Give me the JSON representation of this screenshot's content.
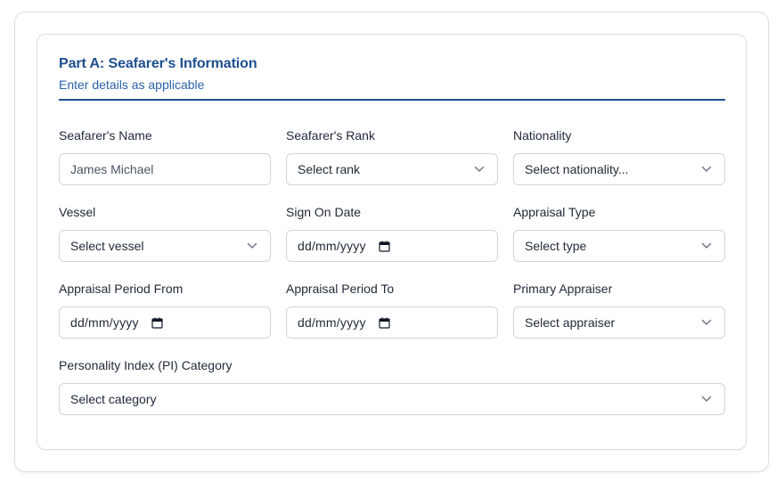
{
  "section": {
    "title": "Part A: Seafarer's Information",
    "subtitle": "Enter details as applicable"
  },
  "fields": {
    "seafarer_name": {
      "label": "Seafarer's Name",
      "value": "James Michael"
    },
    "seafarer_rank": {
      "label": "Seafarer's Rank",
      "value": "Select rank"
    },
    "nationality": {
      "label": "Nationality",
      "value": "Select nationality..."
    },
    "vessel": {
      "label": "Vessel",
      "value": "Select vessel"
    },
    "sign_on_date": {
      "label": "Sign On Date",
      "value": "dd/mm/yyyy"
    },
    "appraisal_type": {
      "label": "Appraisal Type",
      "value": "Select type"
    },
    "period_from": {
      "label": "Appraisal Period From",
      "value": "dd/mm/yyyy"
    },
    "period_to": {
      "label": "Appraisal Period To",
      "value": "dd/mm/yyyy"
    },
    "primary_appraiser": {
      "label": "Primary Appraiser",
      "value": "Select appraiser"
    },
    "pi_category": {
      "label": "Personality Index (PI) Category",
      "value": "Select category"
    }
  },
  "icons": {
    "dropdown": "chevron-down-icon",
    "date": "calendar-icon"
  },
  "colors": {
    "accent": "#1e4f8f",
    "subtitle": "#2b62a8",
    "border": "#d1d5db"
  }
}
